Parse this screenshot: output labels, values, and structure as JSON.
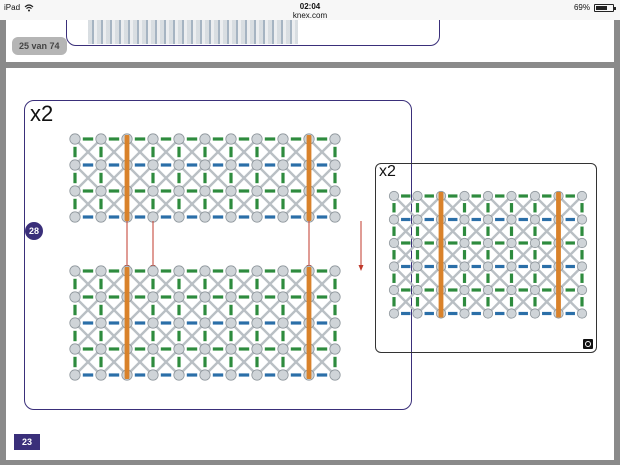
{
  "statusbar": {
    "device": "iPad",
    "time": "02:04",
    "url": "knex.com",
    "battery": "69%",
    "battery_fraction": 0.69
  },
  "reader": {
    "page_indicator": "25 van 74",
    "page_number": "23"
  },
  "instructions": {
    "main_multiplier": "x2",
    "step_number": "28",
    "side_multiplier": "x2"
  },
  "colors": {
    "frame": "#3a2f7a",
    "rod_orange": "#d9822b",
    "rod_green": "#2e8b3e",
    "rod_blue": "#2b6fa8",
    "connector_grey": "#cfd4d8",
    "arrow_red": "#c0392b"
  },
  "icons": [
    "wifi-icon",
    "battery-icon",
    "rotate-icon"
  ]
}
